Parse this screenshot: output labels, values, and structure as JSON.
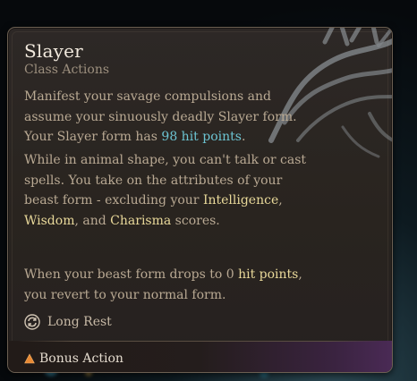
{
  "tooltip": {
    "title": "Slayer",
    "subtitle": "Class Actions",
    "description": {
      "p1_text": "Manifest your savage compulsions and assume your sinuously deadly Slayer form. Your Slayer form has ",
      "p1_highlight": "98 hit points",
      "p1_end": ".",
      "p2_text": "While in animal shape, you can't talk or cast spells. You take on the attributes of your beast form - excluding your ",
      "p2_attr1": "Intelligence",
      "p2_sep1": ", ",
      "p2_attr2": "Wisdom",
      "p2_sep2": ", and ",
      "p2_attr3": "Charisma",
      "p2_end": " scores.",
      "p3_text": "When your beast form drops to 0 ",
      "p3_highlight": "hit points",
      "p3_end": ", you revert to your normal form."
    },
    "rest": {
      "label": "Long Rest",
      "icon": "long-rest-icon"
    },
    "action_type": {
      "label": "Bonus Action",
      "icon": "bonus-action-triangle-icon",
      "icon_color": "#e98a34"
    },
    "colors": {
      "highlight_blue": "#6cc4d2",
      "highlight_gold": "#e9d99a",
      "body_text": "#b9a993"
    }
  }
}
